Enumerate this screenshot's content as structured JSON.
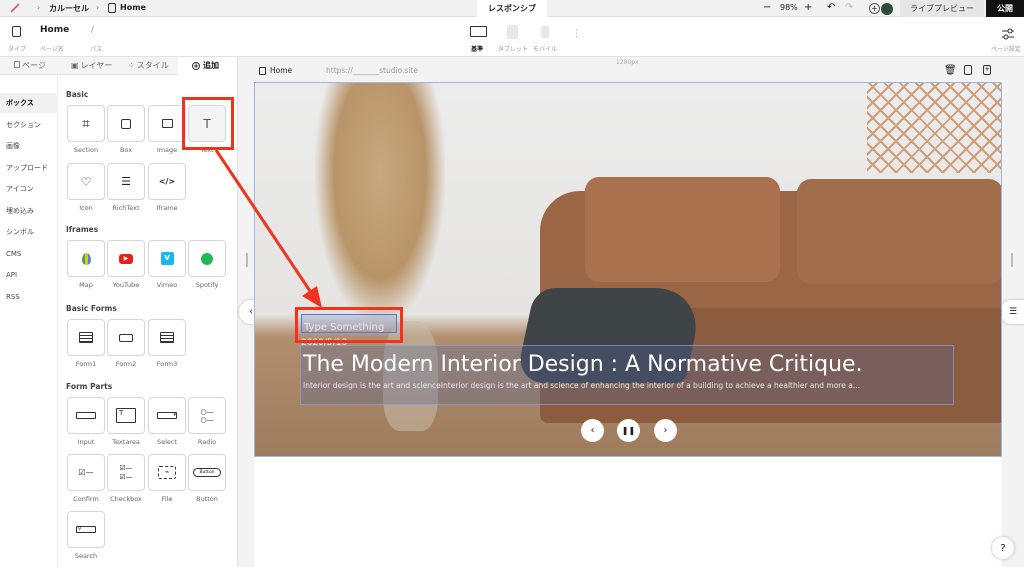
{
  "topbar": {
    "breadcrumb_project": "カルーセル",
    "breadcrumb_page": "Home",
    "center_tab": "レスポンシブ",
    "zoom": "98%",
    "live_preview": "ライブプレビュー",
    "publish": "公開"
  },
  "toolbar": {
    "page_title": "Home",
    "path": "/",
    "label_type": "タイプ",
    "label_page_name": "ページ名",
    "label_path": "パス",
    "device_base": "基準",
    "device_tablet": "タブレット",
    "device_mobile": "モバイル",
    "page_settings": "ページ設定"
  },
  "panel": {
    "tabs": [
      "ページ",
      "レイヤー",
      "スタイル",
      "追加"
    ],
    "categories": [
      "ボックス",
      "セクション",
      "画像",
      "アップロード",
      "アイコン",
      "埋め込み",
      "シンボル",
      "CMS",
      "API",
      "RSS"
    ],
    "sections": {
      "basic": {
        "title": "Basic",
        "items": [
          "Section",
          "Box",
          "Image",
          "Text",
          "Icon",
          "RichText",
          "Iframe"
        ]
      },
      "iframes": {
        "title": "Iframes",
        "items": [
          "Map",
          "YouTube",
          "Vimeo",
          "Spotify"
        ]
      },
      "basic_forms": {
        "title": "Basic Forms",
        "items": [
          "Form1",
          "Form2",
          "Form3"
        ]
      },
      "form_parts": {
        "title": "Form Parts",
        "items": [
          "Input",
          "Textarea",
          "Select",
          "Radio",
          "Confirm",
          "Checkbox",
          "File",
          "Button",
          "Search"
        ]
      }
    }
  },
  "canvas": {
    "page_label": "Home",
    "url": "https://_______studio.site",
    "width_label": "1280px",
    "hero": {
      "placeholder": "Type Something",
      "date": "2020/5/18",
      "title": "The Modern Interior Design : A Normative Critique.",
      "description": "Interior design is the art and scienceInterior design is the art and science of enhancing the interior of a building to achieve a healthier and more a..."
    },
    "button_inner_label": "Button"
  },
  "help": "?"
}
